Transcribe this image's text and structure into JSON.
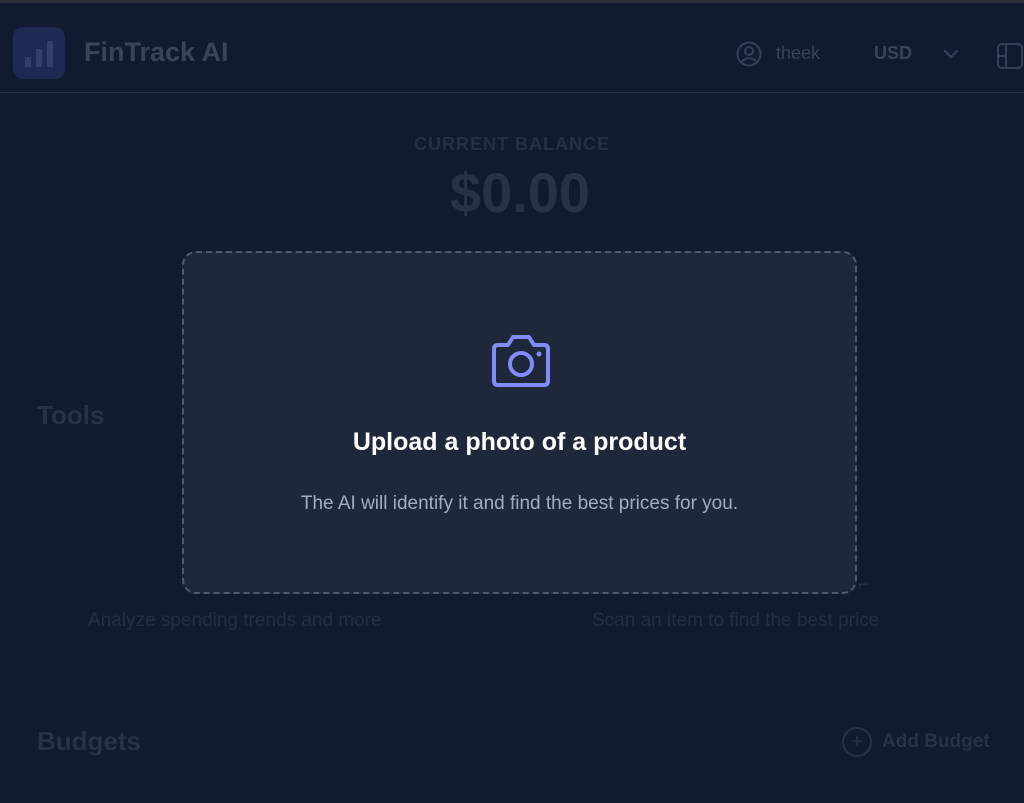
{
  "header": {
    "app_title": "FinTrack AI",
    "user_name": "theek",
    "currency": "USD"
  },
  "balance": {
    "label": "CURRENT BALANCE",
    "value": "$0.00"
  },
  "tools": {
    "heading": "Tools",
    "items": [
      {
        "description": "Analyze spending trends and more"
      },
      {
        "description": "Scan an item to find the best price"
      }
    ]
  },
  "budgets": {
    "heading": "Budgets",
    "add_label": "Add Budget"
  },
  "upload_modal": {
    "title": "Upload a photo of a product",
    "subtitle": "The AI will identify it and find the best prices for you.",
    "icon": "camera-icon",
    "accent_color": "#818cf8"
  }
}
